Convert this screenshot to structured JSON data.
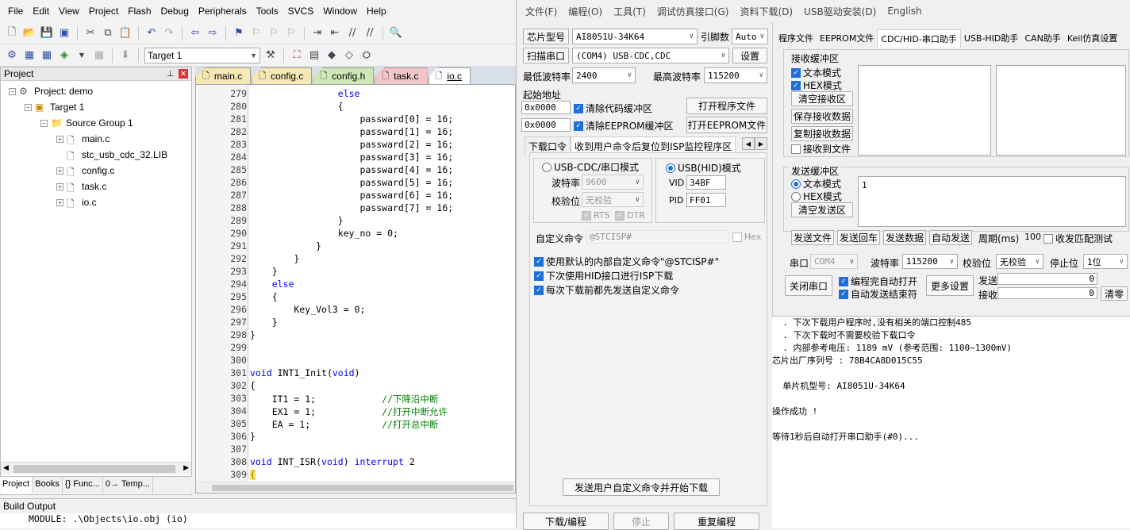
{
  "keil": {
    "menu": [
      "File",
      "Edit",
      "View",
      "Project",
      "Flash",
      "Debug",
      "Peripherals",
      "Tools",
      "SVCS",
      "Window",
      "Help"
    ],
    "target_combo": "Target 1",
    "project_panel": {
      "title": "Project",
      "pin": "ᵖ",
      "close": "x",
      "tree": [
        {
          "label": "Project: demo",
          "level": 0,
          "expander": "−",
          "icon": "project-icon"
        },
        {
          "label": "Target 1",
          "level": 1,
          "expander": "−",
          "icon": "target-icon"
        },
        {
          "label": "Source Group 1",
          "level": 2,
          "expander": "−",
          "icon": "folder-icon"
        },
        {
          "label": "main.c",
          "level": 3,
          "expander": "+",
          "icon": "file-icon"
        },
        {
          "label": "stc_usb_cdc_32.LIB",
          "level": 3,
          "expander": "",
          "icon": "file-icon"
        },
        {
          "label": "config.c",
          "level": 3,
          "expander": "+",
          "icon": "file-icon"
        },
        {
          "label": "task.c",
          "level": 3,
          "expander": "+",
          "icon": "file-icon"
        },
        {
          "label": "io.c",
          "level": 3,
          "expander": "+",
          "icon": "file-icon"
        }
      ],
      "bottom_tabs": [
        "Project",
        "Books",
        "{} Func...",
        "0→ Temp..."
      ]
    },
    "editor_tabs": [
      {
        "label": "main.c",
        "color": "#f5e8b5"
      },
      {
        "label": "config.c",
        "color": "#f5e8b5"
      },
      {
        "label": "config.h",
        "color": "#cfe8b5"
      },
      {
        "label": "task.c",
        "color": "#f2c6c9"
      },
      {
        "label": "io.c",
        "color": "#ffffff"
      }
    ],
    "code": [
      {
        "n": "279",
        "segs": [
          [
            "                ",
            ""
          ],
          [
            "else",
            "kw"
          ]
        ]
      },
      {
        "n": "280",
        "segs": [
          [
            "                {",
            ""
          ]
        ]
      },
      {
        "n": "281",
        "segs": [
          [
            "                    passward[0] = 16;",
            ""
          ]
        ]
      },
      {
        "n": "282",
        "segs": [
          [
            "                    passward[1] = 16;",
            ""
          ]
        ]
      },
      {
        "n": "283",
        "segs": [
          [
            "                    passward[2] = 16;",
            ""
          ]
        ]
      },
      {
        "n": "284",
        "segs": [
          [
            "                    passward[3] = 16;",
            ""
          ]
        ]
      },
      {
        "n": "285",
        "segs": [
          [
            "                    passward[4] = 16;",
            ""
          ]
        ]
      },
      {
        "n": "286",
        "segs": [
          [
            "                    passward[5] = 16;",
            ""
          ]
        ]
      },
      {
        "n": "287",
        "segs": [
          [
            "                    passward[6] = 16;",
            ""
          ]
        ]
      },
      {
        "n": "288",
        "segs": [
          [
            "                    passward[7] = 16;",
            ""
          ]
        ]
      },
      {
        "n": "289",
        "segs": [
          [
            "                }",
            ""
          ]
        ]
      },
      {
        "n": "290",
        "segs": [
          [
            "                key_no = 0;",
            ""
          ]
        ]
      },
      {
        "n": "291",
        "segs": [
          [
            "            }",
            ""
          ]
        ]
      },
      {
        "n": "292",
        "segs": [
          [
            "        }",
            ""
          ]
        ]
      },
      {
        "n": "293",
        "segs": [
          [
            "    }",
            ""
          ]
        ]
      },
      {
        "n": "294",
        "segs": [
          [
            "    ",
            ""
          ],
          [
            "else",
            "kw"
          ]
        ]
      },
      {
        "n": "295",
        "segs": [
          [
            "    {",
            ""
          ]
        ]
      },
      {
        "n": "296",
        "segs": [
          [
            "        Key_Vol3 = 0;",
            ""
          ]
        ]
      },
      {
        "n": "297",
        "segs": [
          [
            "    }",
            ""
          ]
        ]
      },
      {
        "n": "298",
        "segs": [
          [
            "}",
            ""
          ]
        ]
      },
      {
        "n": "299",
        "segs": [
          [
            "",
            ""
          ]
        ]
      },
      {
        "n": "300",
        "segs": [
          [
            "",
            ""
          ]
        ]
      },
      {
        "n": "301",
        "segs": [
          [
            "void",
            "kw"
          ],
          [
            " INT1_Init(",
            ""
          ],
          [
            "void",
            "kw"
          ],
          [
            ")",
            ""
          ]
        ]
      },
      {
        "n": "302",
        "segs": [
          [
            "{",
            ""
          ]
        ]
      },
      {
        "n": "303",
        "segs": [
          [
            "    IT1 = 1;            ",
            ""
          ],
          [
            "//下降沿中断",
            "cm"
          ]
        ]
      },
      {
        "n": "304",
        "segs": [
          [
            "    EX1 = 1;            ",
            ""
          ],
          [
            "//打开中断允许",
            "cm"
          ]
        ]
      },
      {
        "n": "305",
        "segs": [
          [
            "    EA = 1;             ",
            ""
          ],
          [
            "//打开总中断",
            "cm"
          ]
        ]
      },
      {
        "n": "306",
        "segs": [
          [
            "}",
            ""
          ]
        ]
      },
      {
        "n": "307",
        "segs": [
          [
            "",
            ""
          ]
        ]
      },
      {
        "n": "308",
        "segs": [
          [
            "void",
            "kw"
          ],
          [
            " INT_ISR(",
            ""
          ],
          [
            "void",
            "kw"
          ],
          [
            ") ",
            ""
          ],
          [
            "interrupt",
            "kw"
          ],
          [
            " 2",
            ""
          ]
        ]
      },
      {
        "n": "309",
        "segs": [
          [
            "{",
            ""
          ]
        ]
      }
    ],
    "build_output": {
      "title": "Build Output",
      "line": "MODULE:  .\\Objects\\io.obj (io)"
    }
  },
  "stc": {
    "menu": [
      "文件(F)",
      "编程(O)",
      "工具(T)",
      "调试仿真接口(G)",
      "资料下载(D)",
      "USB驱动安装(D)",
      "English"
    ],
    "chip_btn": "芯片型号",
    "chip_value": "AI8051U-34K64",
    "pin_label": "引脚数",
    "pin_value": "Auto",
    "scan_btn": "扫描串口",
    "port_value": "(COM4) USB-CDC,CDC",
    "settings_btn": "设置",
    "min_baud_label": "最低波特率",
    "min_baud": "2400",
    "max_baud_label": "最高波特率",
    "max_baud": "115200",
    "start_addr_label": "起始地址",
    "addr1": "0x0000",
    "clear_code": "清除代码缓冲区",
    "open_prog_btn": "打开程序文件",
    "addr2": "0x0000",
    "clear_eeprom": "清除EEPROM缓冲区",
    "open_eeprom_btn": "打开EEPROM文件",
    "sub_tabs": [
      "下载口令",
      "收到用户命令后复位到ISP监控程序区"
    ],
    "usb_cdc_label": "USB-CDC/串口模式",
    "usb_hid_label": "USB(HID)模式",
    "baud_label": "波特率",
    "baud_val": "9600",
    "parity_label": "校验位",
    "parity_val": "无校验",
    "rts": "RTS",
    "dtr": "DTR",
    "vid_label": "VID",
    "vid": "34BF",
    "pid_label": "PID",
    "pid": "FF01",
    "custom_cmd_label": "自定义命令",
    "custom_cmd_val": "@STCISP#",
    "hex_label": "Hex",
    "opt1": "使用默认的内部自定义命令\"@STCISP#\"",
    "opt2": "下次使用HID接口进行ISP下载",
    "opt3": "每次下载前都先发送自定义命令",
    "send_cmd_btn": "发送用户自定义命令并开始下载",
    "download_btn": "下载/编程",
    "stop_btn": "停止",
    "reprog_btn": "重复编程",
    "right_tabs": [
      "程序文件",
      "EEPROM文件",
      "CDC/HID-串口助手",
      "USB-HID助手",
      "CAN助手",
      "Keil仿真设置"
    ],
    "recv_label": "接收缓冲区",
    "recv_text": "文本模式",
    "recv_hex": "HEX模式",
    "clear_recv": "清空接收区",
    "save_recv": "保存接收数据",
    "copy_recv": "复制接收数据",
    "recv_to_file": "接收到文件",
    "send_label": "发送缓冲区",
    "send_text": "文本模式",
    "send_hex": "HEX模式",
    "clear_send": "清空发送区",
    "send_content": "1",
    "send_file": "发送文件",
    "send_cr": "发送回车",
    "send_data": "发送数据",
    "auto_send": "自动发送",
    "period_label": "周期(ms)",
    "period_val": "100",
    "match_test": "收发匹配测试",
    "port_label": "串口",
    "port_val": "COM4",
    "baud2_label": "波特率",
    "baud2_val": "115200",
    "parity2_label": "校验位",
    "parity2_val": "无校验",
    "stop_label": "停止位",
    "stop_val": "1位",
    "close_port_btn": "关闭串口",
    "auto_open": "编程完自动打开",
    "auto_end": "自动发送结束符",
    "more_settings": "更多设置",
    "sent_label": "发送",
    "sent_count": "0",
    "recv_count_label": "接收",
    "recv_count": "0",
    "clear_count_btn": "清零",
    "log": [
      "  . 下次下载用户程序时,没有相关的端口控制485",
      "  . 下次下载时不需要校验下载口令",
      "  . 内部参考电压: 1189 mV (参考范围: 1100~1300mV)",
      "芯片出厂序列号 : 78B4CA8D015C55",
      "",
      "  单片机型号: AI8051U-34K64",
      "",
      "操作成功 !",
      "",
      "等待1秒后自动打开串口助手(#0)..."
    ]
  },
  "colors": {
    "blue_accent": "#1e6fd6",
    "keyword": "#0000ff",
    "comment": "#008000"
  }
}
